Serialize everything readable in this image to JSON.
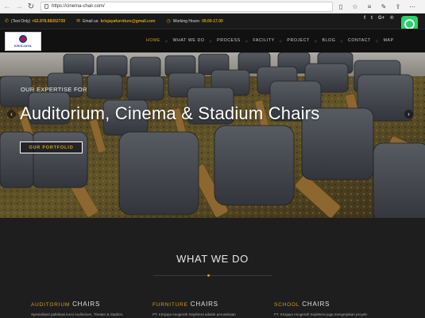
{
  "browser": {
    "url": "https://cinema-chair.com/",
    "back_icon": "arrow-left-icon",
    "forward_icon": "arrow-right-icon",
    "reload_icon": "reload-icon"
  },
  "topbar": {
    "phone_label": "(Text Only)",
    "phone_value": "+62.878.88262739",
    "email_label": "Email us:",
    "email_value": "krisjayafurniture@gmail.com",
    "hours_label": "Working Hours:",
    "hours_value": "09.00-17.00",
    "social": [
      "f",
      "t",
      "G+",
      "®"
    ]
  },
  "header": {
    "logo_text": "KRISJAYA",
    "menu": [
      {
        "label": "HOME",
        "active": true
      },
      {
        "label": "WHAT WE DO",
        "active": false
      },
      {
        "label": "PROCESS",
        "active": false
      },
      {
        "label": "FACILITY",
        "active": false
      },
      {
        "label": "PROJECT",
        "active": false
      },
      {
        "label": "BLOG",
        "active": false
      },
      {
        "label": "CONTACT",
        "active": false
      },
      {
        "label": "MAP",
        "active": false
      }
    ]
  },
  "hero": {
    "eyebrow": "OUR EXPERTISE FOR",
    "headline": "Auditorium, Cinema & Stadium Chairs",
    "button": "OUR PORTFOLIO",
    "prev": "‹",
    "next": "›"
  },
  "section": {
    "title": "WHAT WE DO",
    "columns": [
      {
        "highlight": "AUDITORIUM",
        "title": "CHAIRS",
        "text": "Spesialisasi pabrikasi kursi Auditorium, Theater & Stadion,"
      },
      {
        "highlight": "FURNITURE",
        "title": "CHAIRS",
        "text": "PT. Krisjaya Anugerah Sejahtera adalah perusahaan"
      },
      {
        "highlight": "SCHOOL",
        "title": "CHAIRS",
        "text": "PT. Krisjaya Anugerah Sejahtera juga mengerjakan proyek-"
      }
    ]
  },
  "colors": {
    "accent": "#d4a017",
    "background": "#1e1e1e",
    "whatsapp": "#25d366"
  }
}
